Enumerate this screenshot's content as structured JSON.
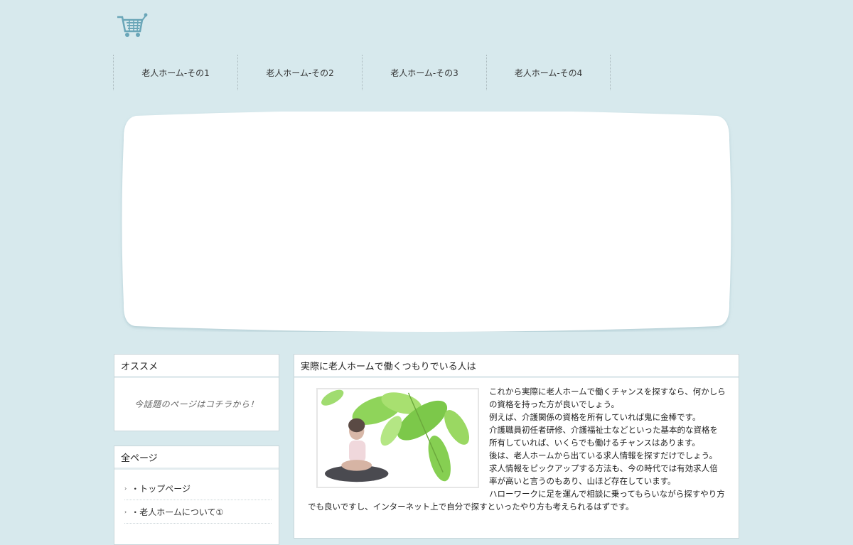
{
  "header": {
    "logo_icon": "shopping-cart-icon",
    "accent_color": "#5b9aae"
  },
  "nav": {
    "items": [
      {
        "label": "老人ホーム-その1"
      },
      {
        "label": "老人ホーム-その2"
      },
      {
        "label": "老人ホーム-その3"
      },
      {
        "label": "老人ホーム-その4"
      }
    ]
  },
  "sidebar": {
    "recommend": {
      "title": "オススメ",
      "text": "今話題のページはコチラから！"
    },
    "all_pages": {
      "title": "全ページ",
      "items": [
        {
          "label": "・トップページ"
        },
        {
          "label": "・老人ホームについて①"
        }
      ]
    }
  },
  "article": {
    "title": "実際に老人ホームで働くつもりでいる人は",
    "paragraphs": [
      "これから実際に老人ホームで働くチャンスを探すなら、何かしらの資格を持った方が良いでしょう。",
      "例えば、介護関係の資格を所有していれば鬼に金棒です。",
      "介護職員初任者研修、介護福祉士などといった基本的な資格を所有していれば、いくらでも働けるチャンスはあります。",
      "後は、老人ホームから出ている求人情報を探すだけでしょう。",
      "求人情報をピックアップする方法も、今の時代では有効求人倍率が高いと言うのもあり、山ほど存在しています。",
      "ハローワークに足を運んで相談に乗ってもらいながら探すやり方でも良いですし、インターネット上で自分で探すといったやり方も考えられるはずです。"
    ]
  }
}
